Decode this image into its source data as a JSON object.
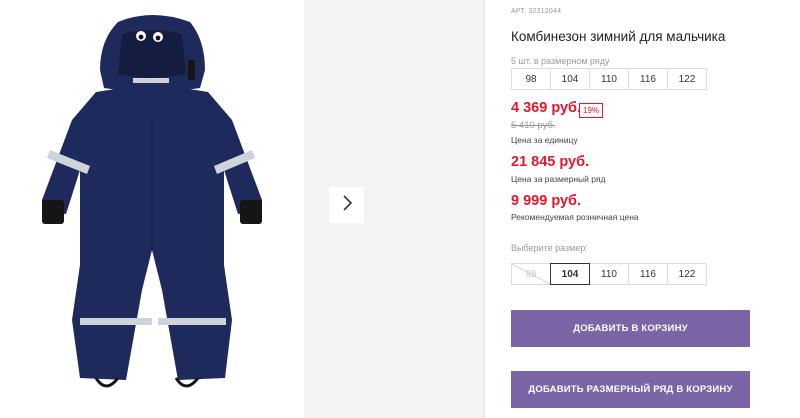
{
  "product": {
    "article": "АРТ. 32312044",
    "title": "Комбинезон зимний для мальчика",
    "pack_label": "5 шт. в размерном ряду",
    "pack_sizes": [
      "98",
      "104",
      "110",
      "116",
      "122"
    ],
    "price": "4 369 руб.",
    "discount": "19%",
    "old_price": "5 410 руб.",
    "price_note": "Цена за единицу",
    "pack_price": "21 845 руб.",
    "pack_price_note": "Цена за размерный ряд",
    "rrp": "9 999 руб.",
    "rrp_note": "Рекомендуемая розничная цена",
    "choose_size_label": "Выберите размер:",
    "sizes": [
      {
        "label": "98",
        "state": "disabled"
      },
      {
        "label": "104",
        "state": "selected"
      },
      {
        "label": "110",
        "state": "available"
      },
      {
        "label": "116",
        "state": "available"
      },
      {
        "label": "122",
        "state": "available"
      }
    ],
    "add_to_cart": "ДОБАВИТЬ В КОРЗИНУ",
    "add_pack_to_cart": "ДОБАВИТЬ РАЗМЕРНЫЙ РЯД В КОРЗИНУ"
  },
  "gallery": {
    "next_icon": "chevron-right-icon",
    "image": "navy-snowsuit"
  },
  "colors": {
    "accent": "#7c65a6",
    "price_red": "#e3182d",
    "suit": "#1f2a5c"
  }
}
